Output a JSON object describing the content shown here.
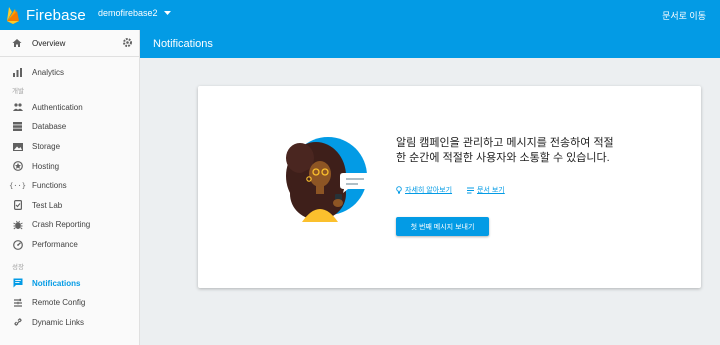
{
  "topbar": {
    "brand": "Firebase",
    "project": "demofirebase2",
    "docs_link": "문서로 이동",
    "color": "#039be5"
  },
  "sidebar": {
    "overview": "Overview",
    "analytics": "Analytics",
    "section_develop": "개발",
    "develop_items": [
      {
        "label": "Authentication",
        "icon": "people-icon"
      },
      {
        "label": "Database",
        "icon": "database-icon"
      },
      {
        "label": "Storage",
        "icon": "storage-icon"
      },
      {
        "label": "Hosting",
        "icon": "hosting-icon"
      },
      {
        "label": "Functions",
        "icon": "functions-icon"
      },
      {
        "label": "Test Lab",
        "icon": "test-lab-icon"
      },
      {
        "label": "Crash Reporting",
        "icon": "bug-icon"
      },
      {
        "label": "Performance",
        "icon": "speed-icon"
      }
    ],
    "section_grow": "성장",
    "grow_items": [
      {
        "label": "Notifications",
        "icon": "chat-icon",
        "active": true
      },
      {
        "label": "Remote Config",
        "icon": "remote-config-icon"
      },
      {
        "label": "Dynamic Links",
        "icon": "link-icon"
      }
    ]
  },
  "main": {
    "title": "Notifications",
    "headline": "알림 캠페인을 관리하고 메시지를 전송하여 적절한 순간에 적절한 사용자와 소통할 수 있습니다.",
    "learn_more": "자세히 알아보기",
    "view_docs": "문서 보기",
    "cta": "첫 번째 메시지 보내기"
  }
}
